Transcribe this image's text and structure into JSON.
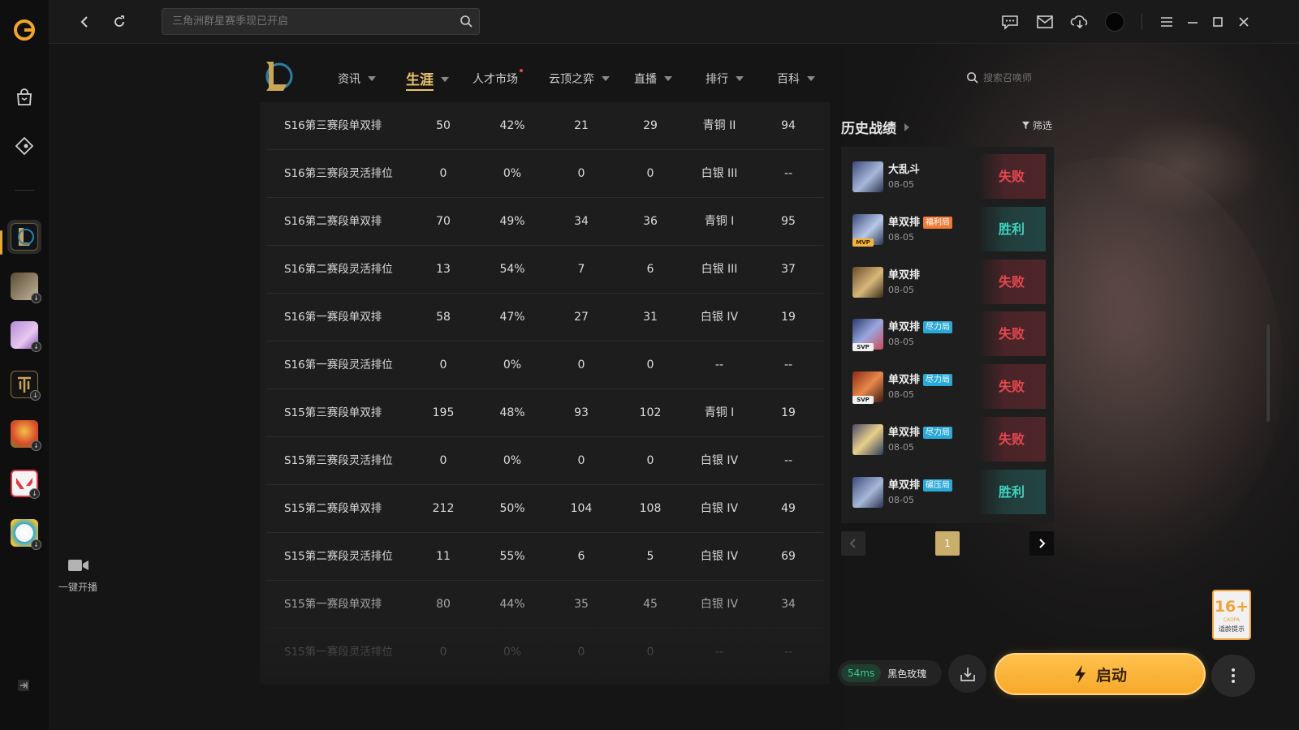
{
  "app": {
    "name": "WeGame",
    "accent": "#e9a83c"
  },
  "topbar": {
    "search_placeholder": "三角洲群星赛季现已开启",
    "icons": [
      "back-icon",
      "refresh-icon",
      "search-icon",
      "chat-icon",
      "mail-icon",
      "download-icon",
      "avatar",
      "menu-icon",
      "minimize-icon",
      "maximize-icon",
      "close-icon"
    ]
  },
  "sidebar": {
    "games": [
      "league-of-legends",
      "game-2",
      "game-3",
      "game-4",
      "game-5",
      "valorant",
      "game-7"
    ],
    "live_label": "一键开播"
  },
  "nav": {
    "tabs": [
      {
        "label": "资讯"
      },
      {
        "label": "生涯",
        "active": true
      },
      {
        "label": "人才市场",
        "new": true
      },
      {
        "label": "云顶之弈"
      },
      {
        "label": "直播"
      },
      {
        "label": "排行"
      },
      {
        "label": "百科"
      }
    ],
    "search_placeholder": "搜索召唤师"
  },
  "ranked_rows": [
    [
      "S16第三赛段单双排",
      "50",
      "42%",
      "21",
      "29",
      "青铜 II",
      "94"
    ],
    [
      "S16第三赛段灵活排位",
      "0",
      "0%",
      "0",
      "0",
      "白银 III",
      "--"
    ],
    [
      "S16第二赛段单双排",
      "70",
      "49%",
      "34",
      "36",
      "青铜 I",
      "95"
    ],
    [
      "S16第二赛段灵活排位",
      "13",
      "54%",
      "7",
      "6",
      "白银 III",
      "37"
    ],
    [
      "S16第一赛段单双排",
      "58",
      "47%",
      "27",
      "31",
      "白银 IV",
      "19"
    ],
    [
      "S16第一赛段灵活排位",
      "0",
      "0%",
      "0",
      "0",
      "--",
      "--"
    ],
    [
      "S15第三赛段单双排",
      "195",
      "48%",
      "93",
      "102",
      "青铜 I",
      "19"
    ],
    [
      "S15第三赛段灵活排位",
      "0",
      "0%",
      "0",
      "0",
      "白银 IV",
      "--"
    ],
    [
      "S15第二赛段单双排",
      "212",
      "50%",
      "104",
      "108",
      "白银 IV",
      "49"
    ],
    [
      "S15第二赛段灵活排位",
      "11",
      "55%",
      "6",
      "5",
      "白银 IV",
      "69"
    ],
    [
      "S15第一赛段单双排",
      "80",
      "44%",
      "35",
      "45",
      "白银 IV",
      "34"
    ],
    [
      "S15第一赛段灵活排位",
      "0",
      "0%",
      "0",
      "0",
      "--",
      "--"
    ]
  ],
  "history": {
    "title": "历史战绩",
    "filter_label": "筛选",
    "matches": [
      {
        "mode": "大乱斗",
        "badge": "",
        "date": "08-05",
        "result": "失败",
        "tag": ""
      },
      {
        "mode": "单双排",
        "badge": "福利局",
        "badge_color": "#f07a35",
        "date": "08-05",
        "result": "胜利",
        "tag": "MVP"
      },
      {
        "mode": "单双排",
        "badge": "",
        "date": "08-05",
        "result": "失败",
        "tag": ""
      },
      {
        "mode": "单双排",
        "badge": "尽力局",
        "badge_color": "#2aa8d8",
        "date": "08-05",
        "result": "失败",
        "tag": "SVP"
      },
      {
        "mode": "单双排",
        "badge": "尽力局",
        "badge_color": "#2aa8d8",
        "date": "08-05",
        "result": "失败",
        "tag": "SVP"
      },
      {
        "mode": "单双排",
        "badge": "尽力局",
        "badge_color": "#2aa8d8",
        "date": "08-05",
        "result": "失败",
        "tag": ""
      },
      {
        "mode": "单双排",
        "badge": "碾压局",
        "badge_color": "#2aa8d8",
        "date": "08-05",
        "result": "胜利",
        "tag": ""
      }
    ],
    "page": "1"
  },
  "bottom": {
    "ping": "54ms",
    "server": "黑色玫瑰",
    "launch_label": "启动",
    "age_rating": "16+",
    "age_org": "CADPA",
    "age_note": "适龄提示"
  }
}
